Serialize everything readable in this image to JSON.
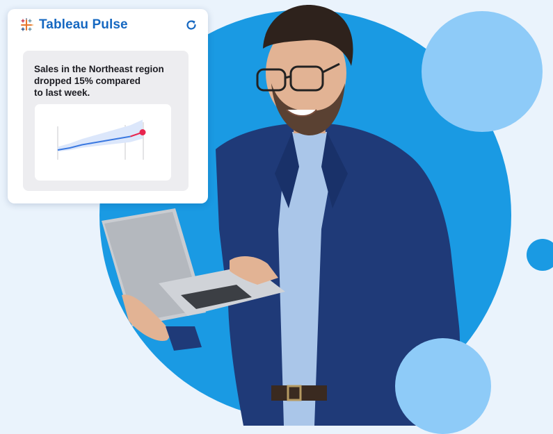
{
  "card": {
    "brand_title": "Tableau Pulse",
    "logo_icon": "tableau-logo-icon",
    "refresh_icon": "refresh-icon",
    "insight_text": "Sales in the Northeast region\ndropped 15% compared\nto last week."
  },
  "colors": {
    "brand_blue": "#1668c1",
    "page_background": "#eaf3fc",
    "circle_primary": "#1a9ae3",
    "circle_light": "#8ecbf8",
    "trend_line": "#3a78e0",
    "trend_band": "#dce7fb",
    "drop_highlight": "#e8264f"
  },
  "chart_data": {
    "type": "line",
    "series": [
      {
        "values": [
          38,
          40,
          43,
          45,
          47,
          49,
          51,
          55
        ]
      }
    ],
    "highlight_last_point": true
  },
  "photo": {
    "subject": "smiling-man-with-laptop"
  }
}
